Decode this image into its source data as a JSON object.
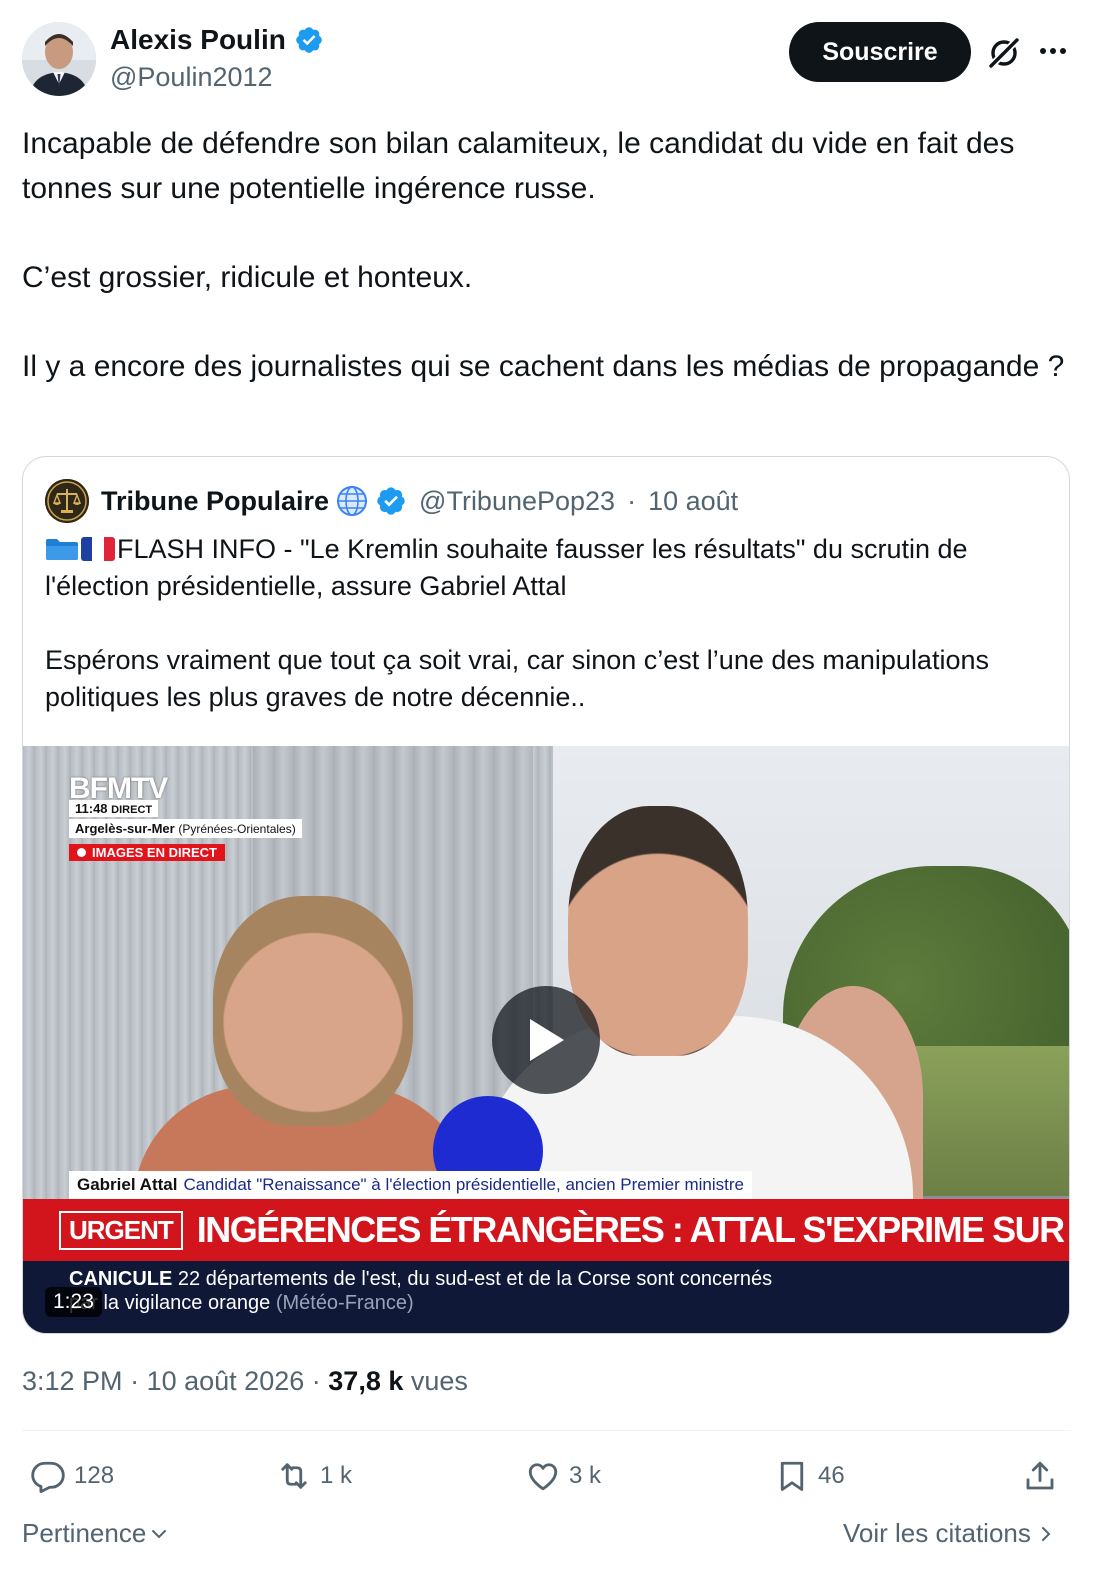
{
  "author": {
    "name": "Alexis Poulin",
    "handle": "@Poulin2012"
  },
  "header": {
    "subscribe_label": "Souscrire"
  },
  "tweet": {
    "paragraphs": [
      "Incapable de défendre son bilan calamiteux, le candidat du vide en fait des tonnes sur une potentielle ingérence russe.",
      "C’est grossier, ridicule et honteux.",
      "Il y a encore des journalistes qui se cachent dans les médias de propagande ?"
    ]
  },
  "quote": {
    "name": "Tribune Populaire",
    "handle": "@TribunePop23",
    "separator": "·",
    "date": "10 août",
    "text_1": "FLASH INFO - \"Le Kremlin souhaite fausser les résultats\" du scrutin de l'élection présidentielle, assure Gabriel Attal",
    "text_2": "Espérons vraiment que tout ça soit vrai, car sinon c’est l’une des manipulations politiques les plus graves de notre décennie..",
    "video": {
      "channel": "BFMTV",
      "time": "11:48",
      "direct": "DIRECT",
      "place_bold": "Argelès-sur-Mer",
      "place_region": "(Pyrénées-Orientales)",
      "live_label": "IMAGES EN DIRECT",
      "speaker_name": "Gabriel Attal",
      "speaker_title": "Candidat \"Renaissance\" à l'élection présidentielle, ancien Premier ministre",
      "urgent_tag": "URGENT",
      "urgent_title": "INGÉRENCES ÉTRANGÈRES : ATTAL S'EXPRIME SUR BFMTV",
      "ticker_bold": "CANICULE",
      "ticker_text": "22 départements de l'est, du sud-est et de la Corse sont concernés",
      "ticker_text_2": "par la vigilance orange",
      "ticker_source": "(Météo-France)",
      "duration": "1:23"
    }
  },
  "meta": {
    "time": "3:12 PM",
    "separator": "·",
    "date": "10 août 2026",
    "views_count": "37,8 k",
    "views_label": "vues"
  },
  "actions": {
    "replies": "128",
    "reposts": "1 k",
    "likes": "3 k",
    "bookmarks": "46"
  },
  "footer": {
    "sort_label": "Pertinence",
    "quotes_label": "Voir les citations"
  },
  "colors": {
    "text": "#0f1419",
    "muted": "#536471",
    "verified": "#1d9bf0",
    "urgent": "#d2141c"
  }
}
